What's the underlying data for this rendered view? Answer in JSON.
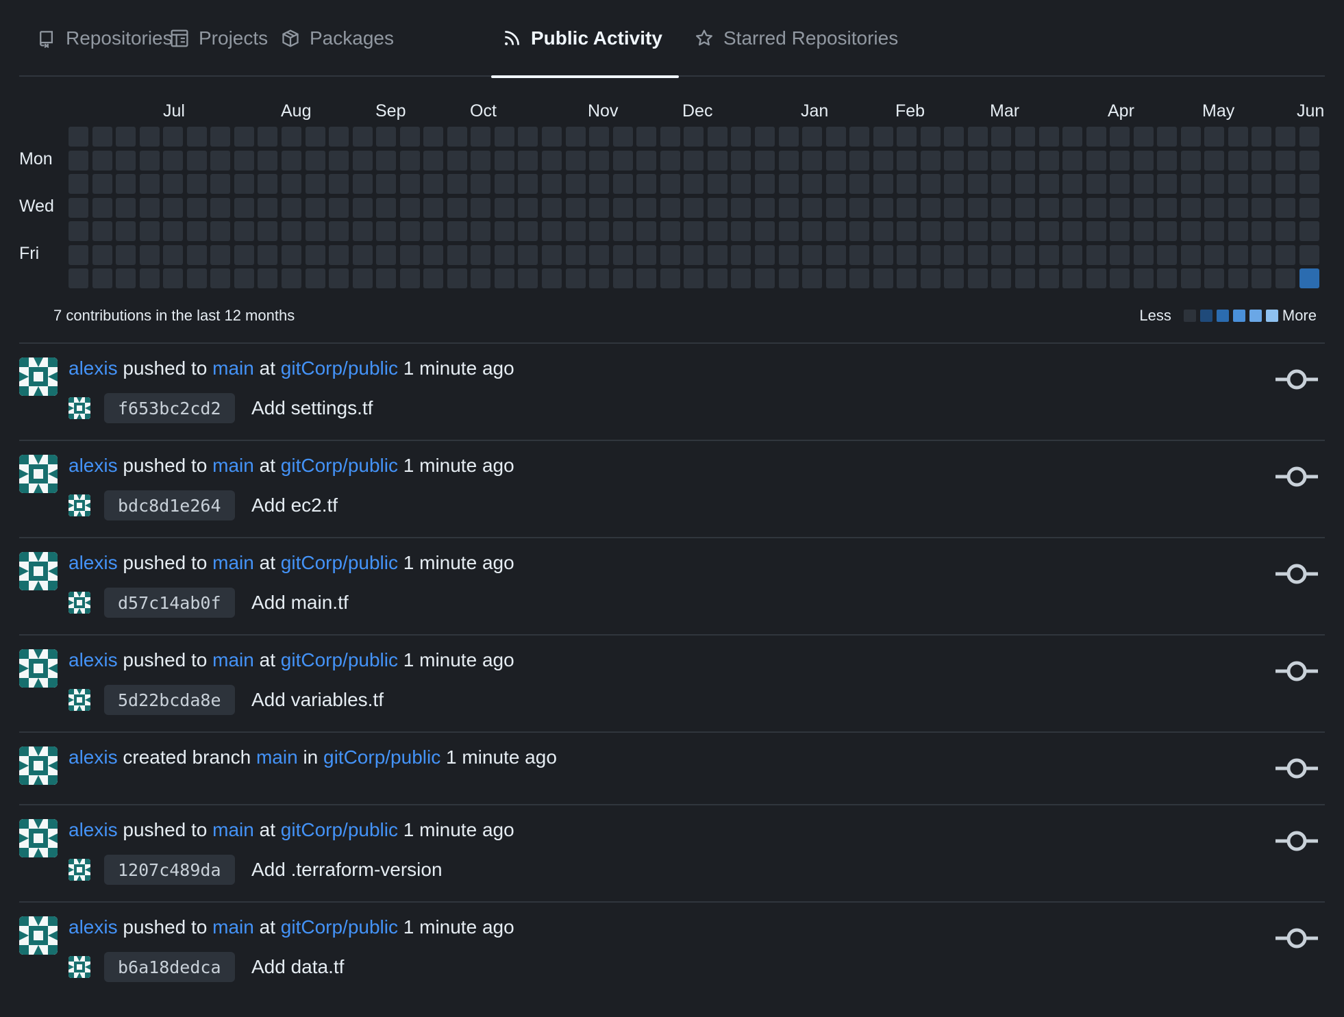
{
  "tabs": [
    {
      "label": "Repositories",
      "icon": "repo-icon",
      "active": false
    },
    {
      "label": "Projects",
      "icon": "project-icon",
      "active": false
    },
    {
      "label": "Packages",
      "icon": "package-icon",
      "active": false
    },
    {
      "label": "Public Activity",
      "icon": "rss-icon",
      "active": true
    },
    {
      "label": "Starred Repositories",
      "icon": "star-icon",
      "active": false
    }
  ],
  "calendar": {
    "months": [
      "Jul",
      "Aug",
      "Sep",
      "Oct",
      "Nov",
      "Dec",
      "Jan",
      "Feb",
      "Mar",
      "Apr",
      "May",
      "Jun"
    ],
    "day_labels": [
      "Mon",
      "Wed",
      "Fri"
    ],
    "weeks": 53,
    "active_cells": [
      {
        "week": 52,
        "day": 6,
        "level": 2
      }
    ],
    "summary": "7 contributions in the last 12 months",
    "legend_less": "Less",
    "legend_more": "More",
    "level_colors": [
      "#2d333b",
      "#1f4a7a",
      "#2b6cb0",
      "#4a90d9",
      "#6aa7e6",
      "#8ec1f0"
    ]
  },
  "colors": {
    "link": "#4493f8",
    "background": "#1c1f24",
    "border": "#30363d",
    "avatar_teal": "#176f6e"
  },
  "feed": [
    {
      "user": "alexis",
      "action": "pushed to",
      "branch": "main",
      "prep": "at",
      "repo": "gitCorp/public",
      "time": "1 minute ago",
      "sha": "f653bc2cd2",
      "message": "Add settings.tf"
    },
    {
      "user": "alexis",
      "action": "pushed to",
      "branch": "main",
      "prep": "at",
      "repo": "gitCorp/public",
      "time": "1 minute ago",
      "sha": "bdc8d1e264",
      "message": "Add ec2.tf"
    },
    {
      "user": "alexis",
      "action": "pushed to",
      "branch": "main",
      "prep": "at",
      "repo": "gitCorp/public",
      "time": "1 minute ago",
      "sha": "d57c14ab0f",
      "message": "Add main.tf"
    },
    {
      "user": "alexis",
      "action": "pushed to",
      "branch": "main",
      "prep": "at",
      "repo": "gitCorp/public",
      "time": "1 minute ago",
      "sha": "5d22bcda8e",
      "message": "Add variables.tf"
    },
    {
      "user": "alexis",
      "action": "created branch",
      "branch": "main",
      "prep": "in",
      "repo": "gitCorp/public",
      "time": "1 minute ago",
      "sha": null,
      "message": null
    },
    {
      "user": "alexis",
      "action": "pushed to",
      "branch": "main",
      "prep": "at",
      "repo": "gitCorp/public",
      "time": "1 minute ago",
      "sha": "1207c489da",
      "message": "Add .terraform-version"
    },
    {
      "user": "alexis",
      "action": "pushed to",
      "branch": "main",
      "prep": "at",
      "repo": "gitCorp/public",
      "time": "1 minute ago",
      "sha": "b6a18dedca",
      "message": "Add data.tf"
    }
  ]
}
